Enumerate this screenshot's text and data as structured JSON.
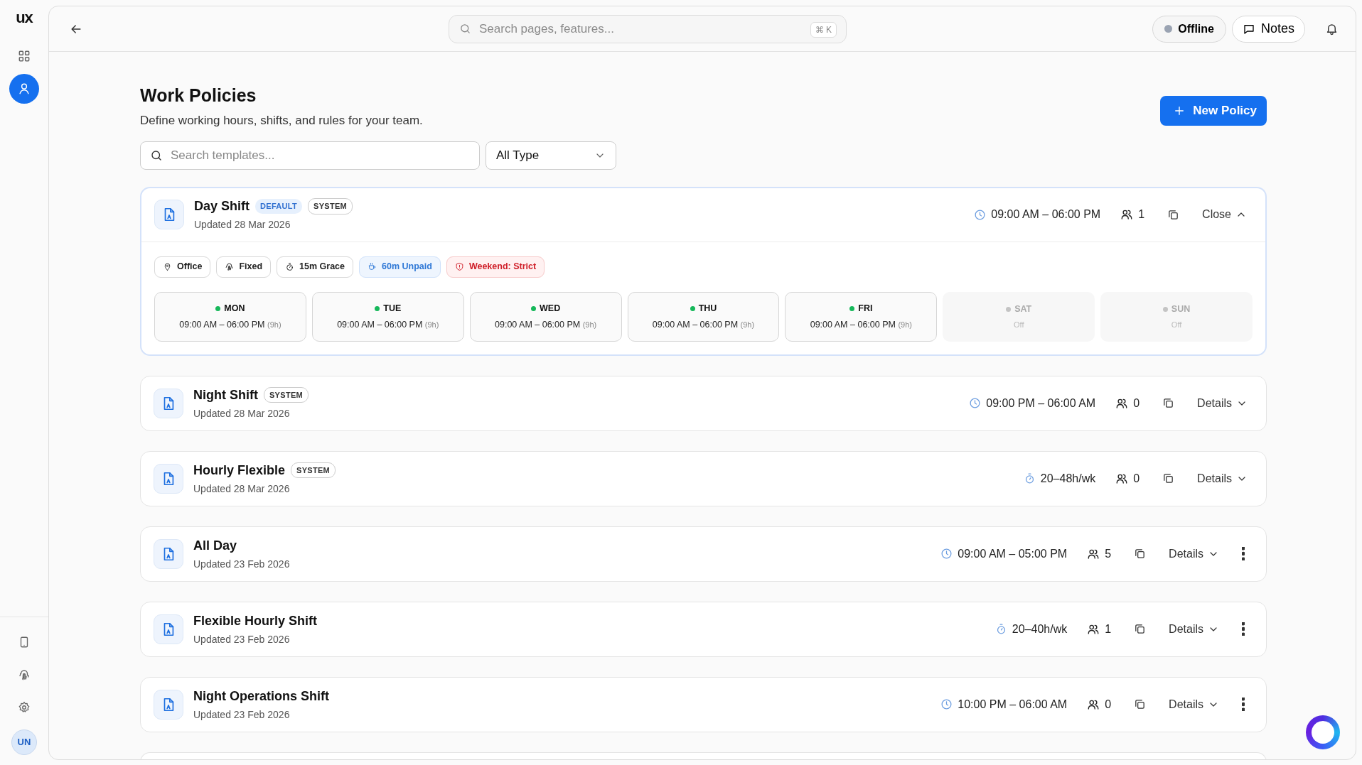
{
  "sidebar": {
    "logo": "ux",
    "items": [
      {
        "kind": "grid",
        "selected": false
      },
      {
        "kind": "user",
        "selected": true
      }
    ],
    "bottom_items": [
      {
        "kind": "tablet"
      },
      {
        "kind": "fingerprint"
      },
      {
        "kind": "gear"
      }
    ],
    "avatar": "UN"
  },
  "topbar": {
    "search": {
      "placeholder": "Search pages, features...",
      "shortcut": "⌘ K"
    },
    "status": {
      "label": "Offline",
      "online": false
    },
    "notes": "Notes"
  },
  "header": {
    "title": "Work Policies",
    "subtitle": "Define working hours, shifts, and rules for your team.",
    "new_button": "New Policy"
  },
  "filters": {
    "search_placeholder": "Search templates...",
    "type": "All Type"
  },
  "policies": [
    {
      "name": "Day Shift",
      "badges": [
        {
          "text": "DEFAULT",
          "kind": "default"
        },
        {
          "text": "SYSTEM",
          "kind": "system"
        }
      ],
      "updated": "Updated 28 Mar 2026",
      "schedule": {
        "kind": "shift",
        "text": "09:00 AM – 06:00 PM"
      },
      "members": "1",
      "action": "Close",
      "expanded": true,
      "menu": false,
      "chips": [
        {
          "kind": "location",
          "text": "Office"
        },
        {
          "kind": "mode",
          "text": "Fixed"
        },
        {
          "kind": "grace",
          "text": "15m Grace"
        },
        {
          "kind": "break",
          "text": "60m Unpaid"
        },
        {
          "kind": "weekend",
          "text": "Weekend: Strict"
        }
      ],
      "days": [
        {
          "label": "MON",
          "hours": "09:00 AM – 06:00 PM",
          "duration": "(9h)",
          "on": true
        },
        {
          "label": "TUE",
          "hours": "09:00 AM – 06:00 PM",
          "duration": "(9h)",
          "on": true
        },
        {
          "label": "WED",
          "hours": "09:00 AM – 06:00 PM",
          "duration": "(9h)",
          "on": true
        },
        {
          "label": "THU",
          "hours": "09:00 AM – 06:00 PM",
          "duration": "(9h)",
          "on": true
        },
        {
          "label": "FRI",
          "hours": "09:00 AM – 06:00 PM",
          "duration": "(9h)",
          "on": true
        },
        {
          "label": "SAT",
          "hours": "Off",
          "on": false
        },
        {
          "label": "SUN",
          "hours": "Off",
          "on": false
        }
      ]
    },
    {
      "name": "Night Shift",
      "badges": [
        {
          "text": "SYSTEM",
          "kind": "system"
        }
      ],
      "updated": "Updated 28 Mar 2026",
      "schedule": {
        "kind": "shift",
        "text": "09:00 PM – 06:00 AM"
      },
      "members": "0",
      "action": "Details",
      "expanded": false,
      "menu": false
    },
    {
      "name": "Hourly Flexible",
      "badges": [
        {
          "text": "SYSTEM",
          "kind": "system"
        }
      ],
      "updated": "Updated 28 Mar 2026",
      "schedule": {
        "kind": "hours",
        "text": "20–48h/wk"
      },
      "members": "0",
      "action": "Details",
      "expanded": false,
      "menu": false
    },
    {
      "name": "All Day",
      "updated": "Updated 23 Feb 2026",
      "schedule": {
        "kind": "shift",
        "text": "09:00 AM – 05:00 PM"
      },
      "members": "5",
      "action": "Details",
      "expanded": false,
      "menu": true
    },
    {
      "name": "Flexible Hourly Shift",
      "updated": "Updated 23 Feb 2026",
      "schedule": {
        "kind": "hours",
        "text": "20–40h/wk"
      },
      "members": "1",
      "action": "Details",
      "expanded": false,
      "menu": true
    },
    {
      "name": "Night Operations Shift",
      "updated": "Updated 23 Feb 2026",
      "schedule": {
        "kind": "shift",
        "text": "10:00 PM – 06:00 AM"
      },
      "members": "0",
      "action": "Details",
      "expanded": false,
      "menu": true
    }
  ]
}
